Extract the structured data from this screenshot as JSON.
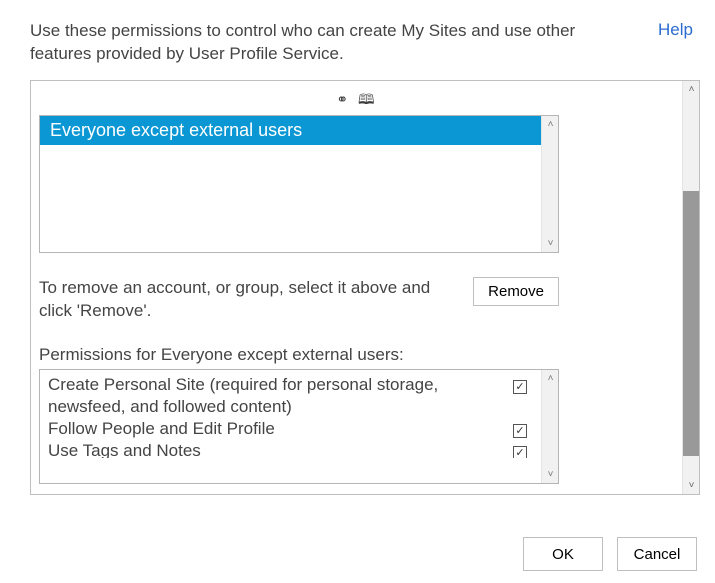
{
  "intro": "Use these permissions to control who can create My Sites and use other features provided by User Profile Service.",
  "help_link": "Help",
  "users": {
    "items": [
      "Everyone except external users"
    ],
    "selected_index": 0
  },
  "remove": {
    "text": "To remove an account, or group, select it above and click 'Remove'.",
    "button": "Remove"
  },
  "permissions_label": "Permissions for Everyone except external users:",
  "permissions": [
    {
      "label": "Create Personal Site (required for personal storage, newsfeed, and followed content)",
      "checked": true
    },
    {
      "label": "Follow People and Edit Profile",
      "checked": true
    },
    {
      "label": "Use Tags and Notes",
      "checked": true
    }
  ],
  "buttons": {
    "ok": "OK",
    "cancel": "Cancel"
  },
  "glyphs": {
    "check": "✓",
    "up": "˄",
    "down": "˅",
    "people": "⚭",
    "book": "🕮"
  }
}
